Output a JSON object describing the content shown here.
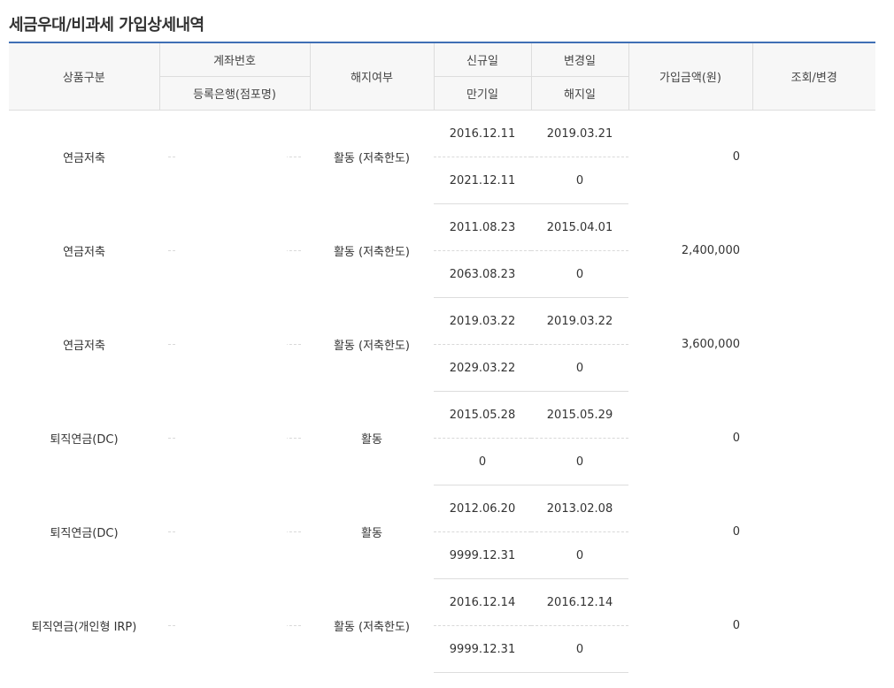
{
  "title": "세금우대/비과세 가입상세내역",
  "headers": {
    "product_type": "상품구분",
    "account_no": "계좌번호",
    "reg_bank": "등록은행(점포명)",
    "termination": "해지여부",
    "new_date": "신규일",
    "change_date": "변경일",
    "maturity_date": "만기일",
    "termination_date": "해지일",
    "amount": "가입금액(원)",
    "action": "조회/변경"
  },
  "rows": [
    {
      "product": "연금저축",
      "status": "활동 (저축한도)",
      "new_date": "2016.12.11",
      "change_date": "2019.03.21",
      "maturity_date": "2021.12.11",
      "termination_date": "0",
      "amount": "0"
    },
    {
      "product": "연금저축",
      "status": "활동 (저축한도)",
      "new_date": "2011.08.23",
      "change_date": "2015.04.01",
      "maturity_date": "2063.08.23",
      "termination_date": "0",
      "amount": "2,400,000"
    },
    {
      "product": "연금저축",
      "status": "활동 (저축한도)",
      "new_date": "2019.03.22",
      "change_date": "2019.03.22",
      "maturity_date": "2029.03.22",
      "termination_date": "0",
      "amount": "3,600,000"
    },
    {
      "product": "퇴직연금(DC)",
      "status": "활동",
      "new_date": "2015.05.28",
      "change_date": "2015.05.29",
      "maturity_date": "0",
      "termination_date": "0",
      "amount": "0"
    },
    {
      "product": "퇴직연금(DC)",
      "status": "활동",
      "new_date": "2012.06.20",
      "change_date": "2013.02.08",
      "maturity_date": "9999.12.31",
      "termination_date": "0",
      "amount": "0"
    },
    {
      "product": "퇴직연금(개인형 IRP)",
      "status": "활동 (저축한도)",
      "new_date": "2016.12.14",
      "change_date": "2016.12.14",
      "maturity_date": "9999.12.31",
      "termination_date": "0",
      "amount": "0"
    }
  ],
  "colors": {
    "accent": "#3f6fb5",
    "header_bg": "#f7f7f7",
    "border": "#dddddd"
  }
}
